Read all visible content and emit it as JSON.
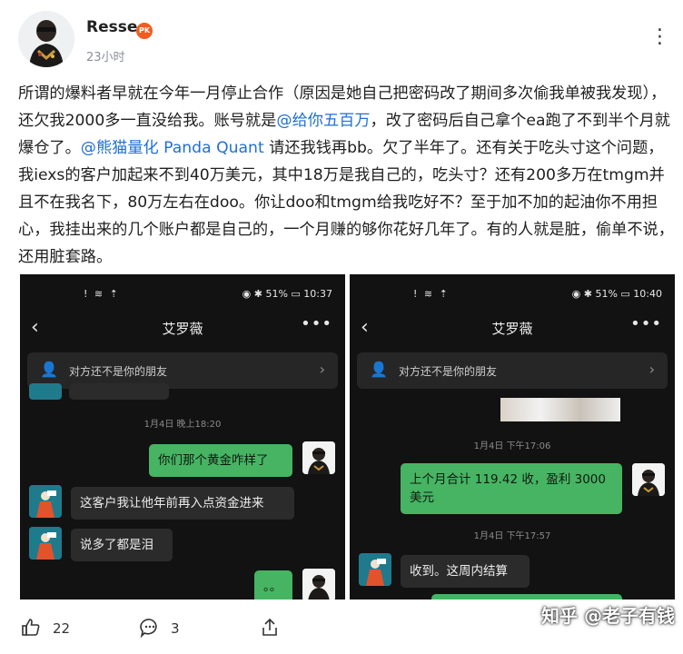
{
  "post": {
    "author": "Resse",
    "badge": "PK",
    "time": "23小时",
    "body_parts": [
      "所谓的爆料者早就在今年一月停止合作（原因是她自己把密码改了期间多次偷我单被我发现），还欠我2000多一直没给我。账号就是",
      "@给你五百万",
      "，改了密码后自己拿个ea跑了不到半个月就爆仓了。",
      "@熊猫量化 Panda Quant",
      " 请还我钱再bb。欠了半年了。还有关于吃头寸这个问题，我iexs的客户加起来不到40万美元，其中18万是我自己的，吃头寸？还有200多万在tmgm并且不在我名下，80万左右在doo。你让doo和tmgm给我吃好不？至于加不加的起油你不用担心，我挂出来的几个账户都是自己的，一个月赚的够你花好几年了。有的人就是脏，偷单不说，还用脏套路。"
    ]
  },
  "shot_left": {
    "status_left": "! ≋ ⇡",
    "status_right": "◉ ✱ 51% ▭ 10:37",
    "title": "艾罗薇",
    "notice": "对方还不是你的朋友",
    "ts1": "1月4日 晚上18:20",
    "msg1": "你们那个黄金咋样了",
    "msg2": "这客户我让他年前再入点资金进来",
    "msg3": "说多了都是泪",
    "msg4": "。。"
  },
  "shot_right": {
    "status_left": "! ≋ ⇡",
    "status_right": "◉ ✱ 51% ▭ 10:40",
    "title": "艾罗薇",
    "notice": "对方还不是你的朋友",
    "ts1": "1月4日 下午17:06",
    "msg1": "上个月合计 119.42 收，盈利 3000 美元",
    "ts2": "1月4日 下午17:57",
    "msg2": "收到。这周内结算"
  },
  "actions": {
    "likes": "22",
    "comments": "3"
  },
  "watermark": "知乎 @老子有钱",
  "colors": {
    "mention": "#1f6fd6",
    "bubble_out": "#46b463",
    "badge": "#f25c1f"
  }
}
